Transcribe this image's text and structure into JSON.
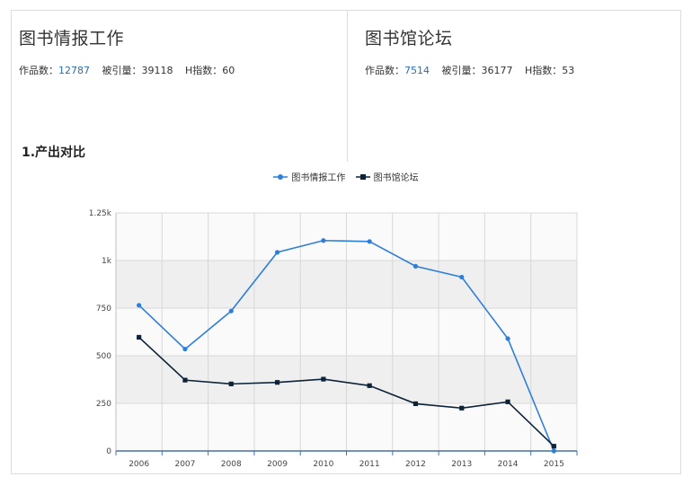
{
  "journals": [
    {
      "title": "图书情报工作",
      "works_label": "作品数：",
      "works": "12787",
      "cited_label": "被引量：",
      "cited": "39118",
      "h_label": "H指数：",
      "h": "60"
    },
    {
      "title": "图书馆论坛",
      "works_label": "作品数：",
      "works": "7514",
      "cited_label": "被引量：",
      "cited": "36177",
      "h_label": "H指数：",
      "h": "53"
    }
  ],
  "section_title": "1.产出对比",
  "colors": {
    "series1": "#2f7ed8",
    "series2": "#0d233a",
    "link": "#2a6db2"
  },
  "chart_data": {
    "type": "line",
    "title": "",
    "xlabel": "",
    "ylabel": "",
    "x": [
      "2006",
      "2007",
      "2008",
      "2009",
      "2010",
      "2011",
      "2012",
      "2013",
      "2014",
      "2015"
    ],
    "ylim": [
      0,
      1250
    ],
    "yticks": [
      0,
      250,
      500,
      750,
      1000,
      1250
    ],
    "ytick_labels": [
      "0",
      "250",
      "500",
      "750",
      "1k",
      "1.25k"
    ],
    "grid": true,
    "legend_position": "top-center",
    "series": [
      {
        "name": "图书情报工作",
        "color": "#2f7ed8",
        "marker": "circle",
        "values": [
          765,
          535,
          735,
          1043,
          1105,
          1100,
          970,
          913,
          590,
          0
        ]
      },
      {
        "name": "图书馆论坛",
        "color": "#0d233a",
        "marker": "square",
        "values": [
          597,
          372,
          352,
          360,
          377,
          343,
          248,
          225,
          258,
          25
        ]
      }
    ]
  }
}
